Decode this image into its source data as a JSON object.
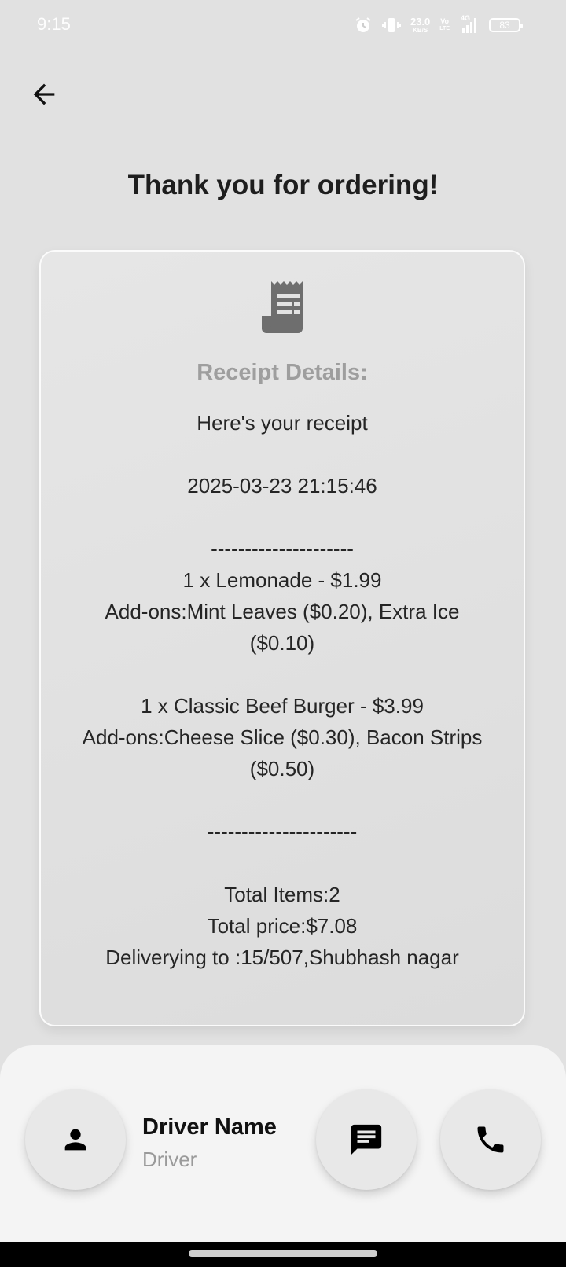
{
  "status_bar": {
    "time": "9:15",
    "net_speed_value": "23.0",
    "net_speed_unit": "KB/S",
    "volte_top": "Vo",
    "volte_bottom": "LTE",
    "network_type": "4G",
    "battery_level": "83"
  },
  "header": {
    "title": "Thank you for ordering!"
  },
  "receipt": {
    "heading": "Receipt Details:",
    "lines": [
      "Here's your receipt",
      "",
      "2025-03-23 21:15:46",
      "",
      "---------------------",
      "1 x Lemonade - $1.99",
      "Add-ons:Mint Leaves ($0.20), Extra Ice ($0.10)",
      "",
      "1 x Classic Beef Burger - $3.99",
      "Add-ons:Cheese Slice ($0.30), Bacon Strips ($0.50)",
      "",
      "----------------------",
      "",
      "Total Items:2",
      "Total price:$7.08",
      "Deliverying to :15/507,Shubhash nagar"
    ]
  },
  "driver": {
    "name": "Driver Name",
    "role": "Driver"
  },
  "colors": {
    "background": "#e1e1e1",
    "card_border": "#fbfbfb",
    "heading_gray": "#9e9e9e",
    "sheet": "#f4f4f4",
    "button": "#e8e8e8"
  }
}
